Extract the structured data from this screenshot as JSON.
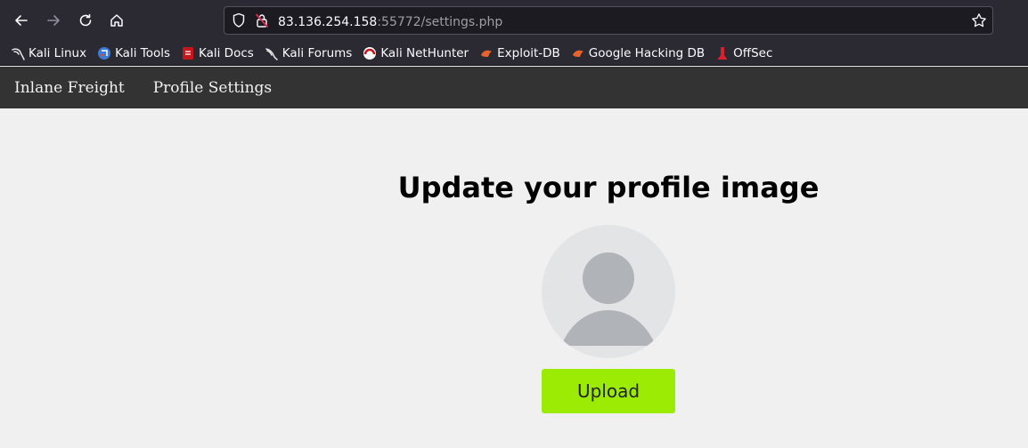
{
  "browser": {
    "url_host": "83.136.254.158",
    "url_rest": ":55772/settings.php",
    "bookmarks": [
      {
        "label": "Kali Linux",
        "icon": "kali-dragon-icon"
      },
      {
        "label": "Kali Tools",
        "icon": "kali-tools-icon"
      },
      {
        "label": "Kali Docs",
        "icon": "kali-docs-icon"
      },
      {
        "label": "Kali Forums",
        "icon": "kali-forums-icon"
      },
      {
        "label": "Kali NetHunter",
        "icon": "nethunter-icon"
      },
      {
        "label": "Exploit-DB",
        "icon": "exploit-db-icon"
      },
      {
        "label": "Google Hacking DB",
        "icon": "ghdb-icon"
      },
      {
        "label": "OffSec",
        "icon": "offsec-icon"
      }
    ]
  },
  "site_nav": {
    "brand": "Inlane Freight",
    "profile_settings": "Profile Settings"
  },
  "main": {
    "title": "Update your profile image",
    "upload_label": "Upload"
  },
  "colors": {
    "upload_button": "#9ceb04",
    "navbar": "#333333",
    "page_bg": "#f0f0f0"
  }
}
